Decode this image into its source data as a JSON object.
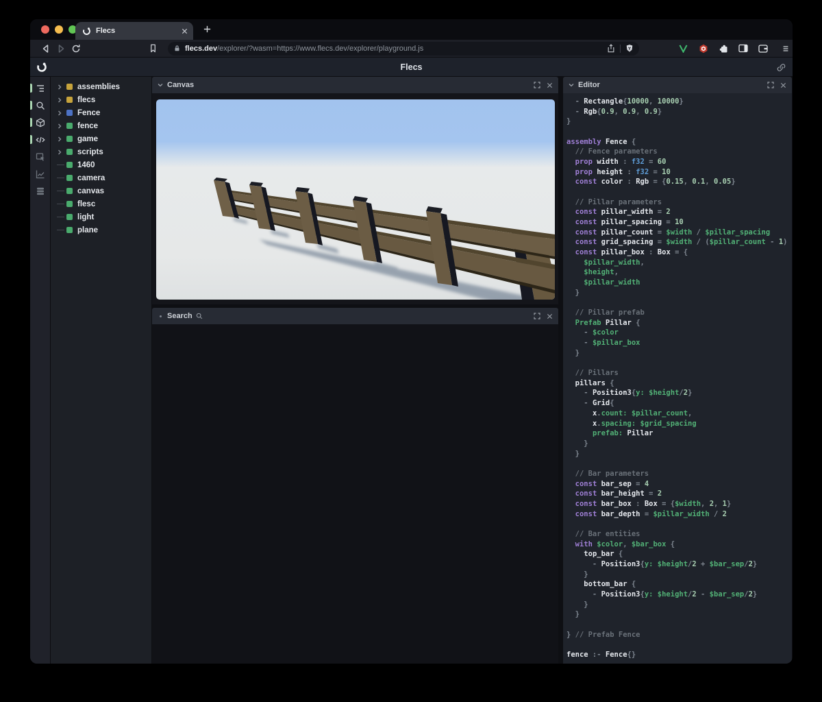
{
  "browser": {
    "tab_title": "Flecs",
    "url_domain": "flecs.dev",
    "url_path": "/explorer/?wasm=https://www.flecs.dev/explorer/playground.js"
  },
  "header": {
    "title": "Flecs"
  },
  "sidebar": {
    "rail": {
      "icons": [
        {
          "name": "entity-tree",
          "active": true
        },
        {
          "name": "query-search",
          "active": true
        },
        {
          "name": "scene-cube",
          "active": true
        },
        {
          "name": "code",
          "active": true
        },
        {
          "name": "inspector",
          "active": false
        },
        {
          "name": "stats-chart",
          "active": false
        },
        {
          "name": "tables-stack",
          "active": false
        }
      ]
    },
    "tree": {
      "items": [
        {
          "label": "assemblies",
          "color": "#c7a43c",
          "expandable": true
        },
        {
          "label": "flecs",
          "color": "#c7a43c",
          "expandable": true
        },
        {
          "label": "Fence",
          "color": "#4d72c4",
          "expandable": true
        },
        {
          "label": "fence",
          "color": "#4aab6d",
          "expandable": true
        },
        {
          "label": "game",
          "color": "#4aab6d",
          "expandable": true
        },
        {
          "label": "scripts",
          "color": "#4aab6d",
          "expandable": true
        },
        {
          "label": "1460",
          "color": "#4aab6d",
          "expandable": false
        },
        {
          "label": "camera",
          "color": "#4aab6d",
          "expandable": false
        },
        {
          "label": "canvas",
          "color": "#4aab6d",
          "expandable": false
        },
        {
          "label": "flesc",
          "color": "#4aab6d",
          "expandable": false
        },
        {
          "label": "light",
          "color": "#4aab6d",
          "expandable": false
        },
        {
          "label": "plane",
          "color": "#4aab6d",
          "expandable": false
        }
      ]
    }
  },
  "panels": {
    "canvas": {
      "title": "Canvas"
    },
    "search": {
      "title": "Search"
    },
    "editor": {
      "title": "Editor"
    }
  },
  "colors": {
    "traffic_close": "#ee6a5f",
    "traffic_min": "#f5bd4f",
    "traffic_zoom": "#61c554",
    "accent_green": "#52b176",
    "keyword_purple": "#9f7fd6",
    "type_blue": "#5e9cd6",
    "sky_blue": "#a2c3ee",
    "fence_brown": "#6c5d45"
  },
  "editor_code": {
    "lines": [
      [
        [
          "p",
          "  - "
        ],
        [
          "i",
          "Rectangle"
        ],
        [
          "p",
          "{"
        ],
        [
          "n",
          "10000"
        ],
        [
          "p",
          ", "
        ],
        [
          "n",
          "10000"
        ],
        [
          "p",
          "}"
        ]
      ],
      [
        [
          "p",
          "  - "
        ],
        [
          "i",
          "Rgb"
        ],
        [
          "p",
          "{"
        ],
        [
          "n",
          "0.9"
        ],
        [
          "p",
          ", "
        ],
        [
          "n",
          "0.9"
        ],
        [
          "p",
          ", "
        ],
        [
          "n",
          "0.9"
        ],
        [
          "p",
          "}"
        ]
      ],
      [
        [
          "p",
          "}"
        ]
      ],
      [],
      [
        [
          "k",
          "assembly "
        ],
        [
          "i",
          "Fence "
        ],
        [
          "p",
          "{"
        ]
      ],
      [
        [
          "c",
          "  // Fence parameters"
        ]
      ],
      [
        [
          "p",
          "  "
        ],
        [
          "k",
          "prop "
        ],
        [
          "i",
          "width "
        ],
        [
          "p",
          ": "
        ],
        [
          "t",
          "f32"
        ],
        [
          "p",
          " = "
        ],
        [
          "n",
          "60"
        ]
      ],
      [
        [
          "p",
          "  "
        ],
        [
          "k",
          "prop "
        ],
        [
          "i",
          "height "
        ],
        [
          "p",
          ": "
        ],
        [
          "t",
          "f32"
        ],
        [
          "p",
          " = "
        ],
        [
          "n",
          "10"
        ]
      ],
      [
        [
          "p",
          "  "
        ],
        [
          "k",
          "const "
        ],
        [
          "i",
          "color "
        ],
        [
          "p",
          ": "
        ],
        [
          "i",
          "Rgb"
        ],
        [
          "p",
          " = {"
        ],
        [
          "n",
          "0.15"
        ],
        [
          "p",
          ", "
        ],
        [
          "n",
          "0.1"
        ],
        [
          "p",
          ", "
        ],
        [
          "n",
          "0.05"
        ],
        [
          "p",
          "}"
        ]
      ],
      [],
      [
        [
          "c",
          "  // Pillar parameters"
        ]
      ],
      [
        [
          "p",
          "  "
        ],
        [
          "k",
          "const "
        ],
        [
          "i",
          "pillar_width"
        ],
        [
          "p",
          " = "
        ],
        [
          "n",
          "2"
        ]
      ],
      [
        [
          "p",
          "  "
        ],
        [
          "k",
          "const "
        ],
        [
          "i",
          "pillar_spacing"
        ],
        [
          "p",
          " = "
        ],
        [
          "n",
          "10"
        ]
      ],
      [
        [
          "p",
          "  "
        ],
        [
          "k",
          "const "
        ],
        [
          "i",
          "pillar_count"
        ],
        [
          "p",
          " = "
        ],
        [
          "v",
          "$width"
        ],
        [
          "p",
          " / "
        ],
        [
          "v",
          "$pillar_spacing"
        ]
      ],
      [
        [
          "p",
          "  "
        ],
        [
          "k",
          "const "
        ],
        [
          "i",
          "grid_spacing"
        ],
        [
          "p",
          " = "
        ],
        [
          "v",
          "$width"
        ],
        [
          "p",
          " / ("
        ],
        [
          "v",
          "$pillar_count"
        ],
        [
          "p",
          " - "
        ],
        [
          "n",
          "1"
        ],
        [
          "p",
          ")"
        ]
      ],
      [
        [
          "p",
          "  "
        ],
        [
          "k",
          "const "
        ],
        [
          "i",
          "pillar_box "
        ],
        [
          "p",
          ": "
        ],
        [
          "i",
          "Box"
        ],
        [
          "p",
          " = {"
        ]
      ],
      [
        [
          "p",
          "    "
        ],
        [
          "v",
          "$pillar_width"
        ],
        [
          "p",
          ","
        ]
      ],
      [
        [
          "p",
          "    "
        ],
        [
          "v",
          "$height"
        ],
        [
          "p",
          ","
        ]
      ],
      [
        [
          "p",
          "    "
        ],
        [
          "v",
          "$pillar_width"
        ]
      ],
      [
        [
          "p",
          "  }"
        ]
      ],
      [],
      [
        [
          "c",
          "  // Pillar prefab"
        ]
      ],
      [
        [
          "p",
          "  "
        ],
        [
          "v",
          "Prefab "
        ],
        [
          "i",
          "Pillar "
        ],
        [
          "p",
          "{"
        ]
      ],
      [
        [
          "p",
          "    - "
        ],
        [
          "v",
          "$color"
        ]
      ],
      [
        [
          "p",
          "    - "
        ],
        [
          "v",
          "$pillar_box"
        ]
      ],
      [
        [
          "p",
          "  }"
        ]
      ],
      [],
      [
        [
          "c",
          "  // Pillars"
        ]
      ],
      [
        [
          "p",
          "  "
        ],
        [
          "i",
          "pillars "
        ],
        [
          "p",
          "{"
        ]
      ],
      [
        [
          "p",
          "    - "
        ],
        [
          "i",
          "Position3"
        ],
        [
          "p",
          "{"
        ],
        [
          "v",
          "y: "
        ],
        [
          "v",
          "$height"
        ],
        [
          "p",
          "/"
        ],
        [
          "n",
          "2"
        ],
        [
          "p",
          "}"
        ]
      ],
      [
        [
          "p",
          "    - "
        ],
        [
          "i",
          "Grid"
        ],
        [
          "p",
          "{"
        ]
      ],
      [
        [
          "p",
          "      "
        ],
        [
          "i",
          "x"
        ],
        [
          "p",
          "."
        ],
        [
          "v",
          "count: "
        ],
        [
          "v",
          "$pillar_count"
        ],
        [
          "p",
          ","
        ]
      ],
      [
        [
          "p",
          "      "
        ],
        [
          "i",
          "x"
        ],
        [
          "p",
          "."
        ],
        [
          "v",
          "spacing: "
        ],
        [
          "v",
          "$grid_spacing"
        ]
      ],
      [
        [
          "p",
          "      "
        ],
        [
          "v",
          "prefab: "
        ],
        [
          "i",
          "Pillar"
        ]
      ],
      [
        [
          "p",
          "    }"
        ]
      ],
      [
        [
          "p",
          "  }"
        ]
      ],
      [],
      [
        [
          "c",
          "  // Bar parameters"
        ]
      ],
      [
        [
          "p",
          "  "
        ],
        [
          "k",
          "const "
        ],
        [
          "i",
          "bar_sep"
        ],
        [
          "p",
          " = "
        ],
        [
          "n",
          "4"
        ]
      ],
      [
        [
          "p",
          "  "
        ],
        [
          "k",
          "const "
        ],
        [
          "i",
          "bar_height"
        ],
        [
          "p",
          " = "
        ],
        [
          "n",
          "2"
        ]
      ],
      [
        [
          "p",
          "  "
        ],
        [
          "k",
          "const "
        ],
        [
          "i",
          "bar_box "
        ],
        [
          "p",
          ": "
        ],
        [
          "i",
          "Box"
        ],
        [
          "p",
          " = {"
        ],
        [
          "v",
          "$width"
        ],
        [
          "p",
          ", "
        ],
        [
          "n",
          "2"
        ],
        [
          "p",
          ", "
        ],
        [
          "n",
          "1"
        ],
        [
          "p",
          "}"
        ]
      ],
      [
        [
          "p",
          "  "
        ],
        [
          "k",
          "const "
        ],
        [
          "i",
          "bar_depth"
        ],
        [
          "p",
          " = "
        ],
        [
          "v",
          "$pillar_width"
        ],
        [
          "p",
          " / "
        ],
        [
          "n",
          "2"
        ]
      ],
      [],
      [
        [
          "c",
          "  // Bar entities"
        ]
      ],
      [
        [
          "p",
          "  "
        ],
        [
          "k",
          "with "
        ],
        [
          "v",
          "$color"
        ],
        [
          "p",
          ", "
        ],
        [
          "v",
          "$bar_box"
        ],
        [
          "p",
          " {"
        ]
      ],
      [
        [
          "p",
          "    "
        ],
        [
          "i",
          "top_bar "
        ],
        [
          "p",
          "{"
        ]
      ],
      [
        [
          "p",
          "      - "
        ],
        [
          "i",
          "Position3"
        ],
        [
          "p",
          "{"
        ],
        [
          "v",
          "y: "
        ],
        [
          "v",
          "$height"
        ],
        [
          "p",
          "/"
        ],
        [
          "n",
          "2"
        ],
        [
          "p",
          " + "
        ],
        [
          "v",
          "$bar_sep"
        ],
        [
          "p",
          "/"
        ],
        [
          "n",
          "2"
        ],
        [
          "p",
          "}"
        ]
      ],
      [
        [
          "p",
          "    }"
        ]
      ],
      [
        [
          "p",
          "    "
        ],
        [
          "i",
          "bottom_bar "
        ],
        [
          "p",
          "{"
        ]
      ],
      [
        [
          "p",
          "      - "
        ],
        [
          "i",
          "Position3"
        ],
        [
          "p",
          "{"
        ],
        [
          "v",
          "y: "
        ],
        [
          "v",
          "$height"
        ],
        [
          "p",
          "/"
        ],
        [
          "n",
          "2"
        ],
        [
          "p",
          " - "
        ],
        [
          "v",
          "$bar_sep"
        ],
        [
          "p",
          "/"
        ],
        [
          "n",
          "2"
        ],
        [
          "p",
          "}"
        ]
      ],
      [
        [
          "p",
          "    }"
        ]
      ],
      [
        [
          "p",
          "  }"
        ]
      ],
      [],
      [
        [
          "p",
          "} "
        ],
        [
          "c",
          "// Prefab Fence"
        ]
      ],
      [],
      [
        [
          "i",
          "fence"
        ],
        [
          "p",
          " :- "
        ],
        [
          "i",
          "Fence"
        ],
        [
          "p",
          "{}"
        ]
      ]
    ]
  }
}
